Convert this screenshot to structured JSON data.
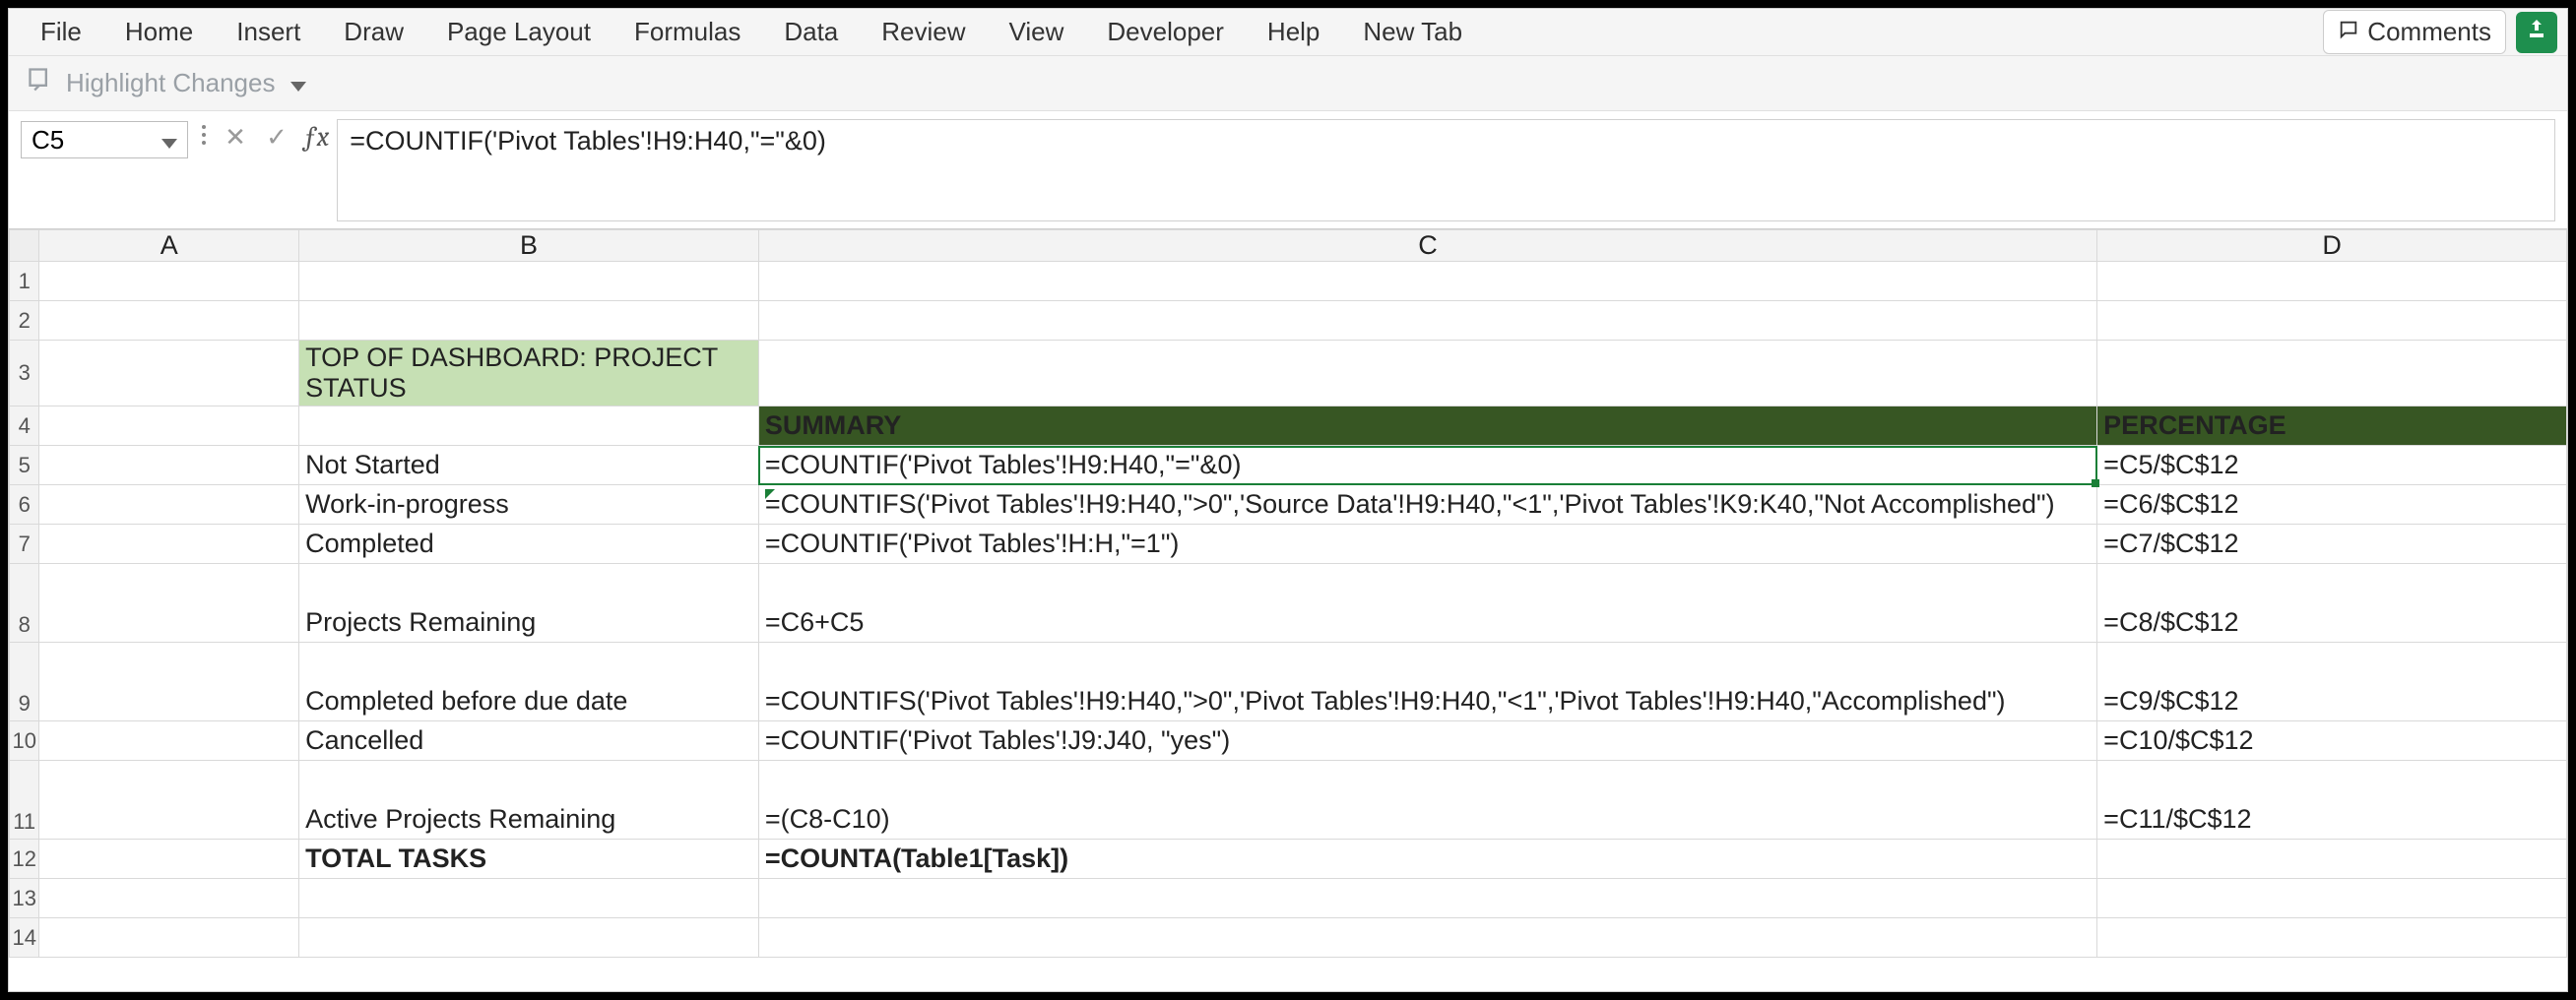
{
  "ribbon": {
    "tabs": [
      "File",
      "Home",
      "Insert",
      "Draw",
      "Page Layout",
      "Formulas",
      "Data",
      "Review",
      "View",
      "Developer",
      "Help",
      "New Tab"
    ],
    "comments": "Comments"
  },
  "toolbar2": {
    "highlight_label": "Highlight Changes"
  },
  "namebox": {
    "value": "C5"
  },
  "formula_bar": {
    "value": "=COUNTIF('Pivot Tables'!H9:H40,\"=\"&0)"
  },
  "columns": {
    "A": "A",
    "B": "B",
    "C": "C",
    "D": "D"
  },
  "rows": {
    "r1": "1",
    "r2": "2",
    "r3": "3",
    "r4": "4",
    "r5": "5",
    "r6": "6",
    "r7": "7",
    "r8": "8",
    "r9": "9",
    "r10": "10",
    "r11": "11",
    "r12": "12",
    "r13": "13",
    "r14": "14"
  },
  "cells": {
    "B3": "TOP OF DASHBOARD: PROJECT STATUS",
    "C4": "SUMMARY",
    "D4": "PERCENTAGE",
    "B5": "Not Started",
    "C5": "=COUNTIF('Pivot Tables'!H9:H40,\"=\"&0)",
    "D5": "=C5/$C$12",
    "B6": "Work-in-progress",
    "C6": "=COUNTIFS('Pivot Tables'!H9:H40,\">0\",'Source Data'!H9:H40,\"<1\",'Pivot Tables'!K9:K40,\"Not Accomplished\")",
    "D6": "=C6/$C$12",
    "B7": "Completed",
    "C7": "=COUNTIF('Pivot Tables'!H:H,\"=1\")",
    "D7": "=C7/$C$12",
    "B8": "Projects Remaining",
    "C8": "=C6+C5",
    "D8": "=C8/$C$12",
    "B9": "Completed before due date",
    "C9": "=COUNTIFS('Pivot Tables'!H9:H40,\">0\",'Pivot Tables'!H9:H40,\"<1\",'Pivot Tables'!H9:H40,\"Accomplished\")",
    "D9": "=C9/$C$12",
    "B10": "Cancelled",
    "C10": "=COUNTIF('Pivot Tables'!J9:J40, \"yes\")",
    "D10": "=C10/$C$12",
    "B11": "Active Projects Remaining",
    "C11": "=(C8-C10)",
    "D11": "=C11/$C$12",
    "B12": "TOTAL TASKS",
    "C12": "=COUNTA(Table1[Task])"
  },
  "colors": {
    "header_green": "#375623",
    "title_fill": "#c6e0b4",
    "selection": "#1a7f37"
  }
}
